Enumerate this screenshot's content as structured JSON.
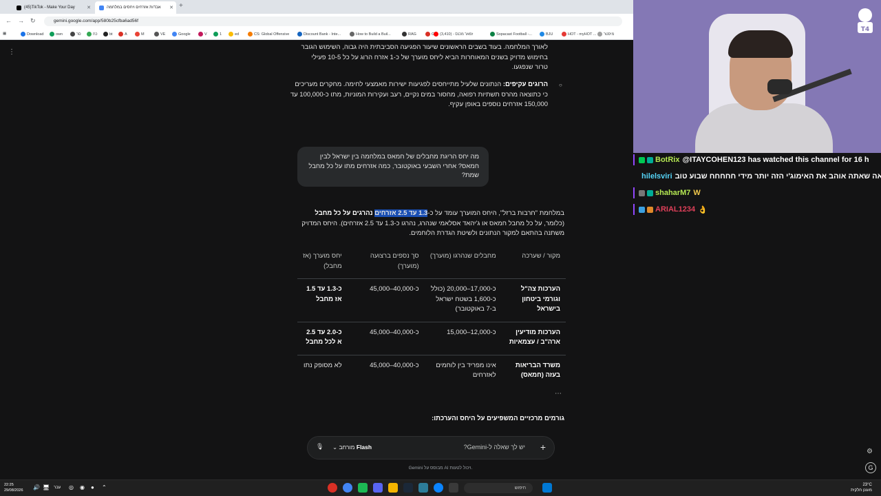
{
  "browser": {
    "tabs": [
      {
        "title": "(45)TikTok - Make Your Day"
      },
      {
        "title": "אבדות אזרחים ויחסים במלחמה"
      }
    ],
    "url": "gemini.google.com/app/580b25cfba6ad56f",
    "bookmarks": [
      "Download",
      "own",
      "סר",
      "כח",
      "bt",
      "A",
      "M",
      "VE",
      "Google",
      "V",
      "1",
      "ed",
      "CS: Global Offensive",
      "Discount Bank - Inte...",
      "How to Build a Buil...",
      "RAG",
      "G",
      "(3,410) - זמאר מכנס",
      "Sopacast Football -...",
      "BJU",
      "HOT - myHOT ...",
      "מיסטר"
    ]
  },
  "gemini": {
    "top_paragraph": "לאורך המלחמה. בעוד בשבים הראשונים שיעור הפגיעה הסביבתית היה גבוה, השימוש הגובר בחימוש מדויק בשנים המאוחרות הביא ליחס מוערך של כ-1 אזרח הרוג על כל 10-5 פעילי טרור שנפגעו.",
    "bullet2_bold": "הרוגים עקיפים:",
    "bullet2_text": " הנתונים שלעיל מתייחסים לפגיעות ישירות מאמצעי לחימה. מחקרים מעריכים כי כתוצאה מהרס תשתיות רפואה, מחסור במים נקיים, רעב ועקירות המוניות, מתו כ-100,000 עד 150,000 אזרחים נוספים באופן עקיף.",
    "user_question": "מה יחס הריגת מחבלים של חמאס במלחמה בין ישראל לבין חמאס? אחרי השבעי באוקטובר, כמה אזרחים מתו על כל מחבל שמת?",
    "answer_pre": "במלחמת \"חרבות ברזל\", היחס המוערך עומד על כ-",
    "answer_highlight": "1.3 עד 2.5 אזרחים",
    "answer_bold_rest": " נהרגים על כל מחבל",
    "answer_post": " (כלומר, על כל מחבל חמאס או ג'יהאד אסלאמי שנהרג, נהרגו כ-1.3 עד 2.5 אזרחים). היחס המדויק משתנה בהתאם למקור הנתונים ולשיטת הגדרת הלוחמים.",
    "table": {
      "headers": [
        "מקור / שערכה",
        "מחבלים שנהרגו (מוערך)",
        "סך נספים ברצועה (מוערך)",
        "יחס מוערך (אז מחבל)"
      ],
      "rows": [
        [
          "הערכות צה\"ל וגורמי ביטחון בישראל",
          "כ-17,000–20,000 (כולל כ-1,600 בשטח ישראל ב-7 באוקטובר)",
          "כ-40,000–45,000",
          "כ-1.3 עד 1.5 אז מחבל"
        ],
        [
          "הערכות מודיעין ארה\"ב / עצמאיות",
          "כ-12,000–15,000",
          "כ-40,000–45,000",
          "כ-2.0 עד 2.5 א לכל מחבל"
        ],
        [
          "משרד הבריאות בעזה (חמאס)",
          "אינו מפריד בין לוחמים לאזרחים",
          "כ-40,000–45,000",
          "לא מסופק נתו"
        ]
      ]
    },
    "factors_heading": "גורמים מרכזיים המשפיעים על היחס והערכתו:",
    "prompt_placeholder": "יש לך שאלה ל-Gemini?",
    "model_label": "Flash",
    "model_prefix": "מורחב",
    "disclaimer": "Gemini מבוסס על AI ויכול לטעות."
  },
  "stream_chat": [
    {
      "user": "BotRix",
      "text": "@ITAYCOHEN123 has watched this channel for 16 h",
      "color": "#b5e853"
    },
    {
      "user": "hilelsviri",
      "text": "אה שאתה אוהב את האימוג'י הזה יותר מידי חחחחח שבוע טוב",
      "color": "#55d4f7"
    },
    {
      "user": "shaharM7",
      "text": "W",
      "color": "#b5e853"
    },
    {
      "user": "ARIAL1234",
      "text": "👌",
      "color": "#e0405a"
    }
  ],
  "taskbar": {
    "time": "22:25",
    "date": "29/08/2026",
    "lang": "עבר",
    "search_placeholder": "חיפוש",
    "weather_temp": "23°C",
    "weather_desc": "מעונן חלקית"
  },
  "colors": {
    "accent_highlight": "#1a4fb3",
    "twitch_purple": "#9147ff",
    "gemini_bg": "#131314"
  }
}
